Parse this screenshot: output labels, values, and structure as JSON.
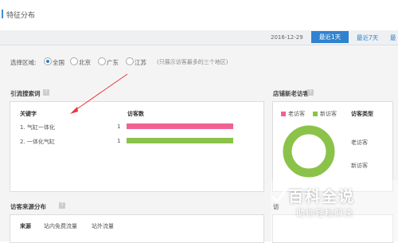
{
  "header": {
    "title": "特征分布"
  },
  "date_bar": {
    "date": "2016-12-29",
    "active_button": "最近1天",
    "button_7": "最近7天",
    "button_30": "最"
  },
  "region": {
    "label": "选择区域:",
    "options": [
      "全国",
      "北京",
      "广东",
      "江苏"
    ],
    "selected": "全国",
    "note": "(只展示访客最多的三个地区)"
  },
  "keywords": {
    "title": "引流搜索词",
    "col_keyword": "关键字",
    "col_visitors": "访客数",
    "rows": [
      {
        "label": "1. 气缸一体化",
        "value": "1",
        "color": "#f06292"
      },
      {
        "label": "2. 一体化气缸",
        "value": "1",
        "color": "#8bc34a"
      }
    ]
  },
  "visitor_types": {
    "title": "店铺新老访客",
    "legend_old": "老访客",
    "legend_new": "新访客",
    "type_header": "访客类型",
    "type_old": "老访客",
    "type_new": "新访客",
    "colors": {
      "old": "#f06292",
      "new": "#8bc34a"
    }
  },
  "source": {
    "title": "访客来源分布",
    "tab_source": "来源",
    "tab_inner": "站内免费流量",
    "tab_outer": "站外流量",
    "right_title_fragment": "访"
  },
  "watermark": {
    "line1": "百科全说",
    "line2": "助你轻松解决"
  },
  "help_icon_text": "?"
}
